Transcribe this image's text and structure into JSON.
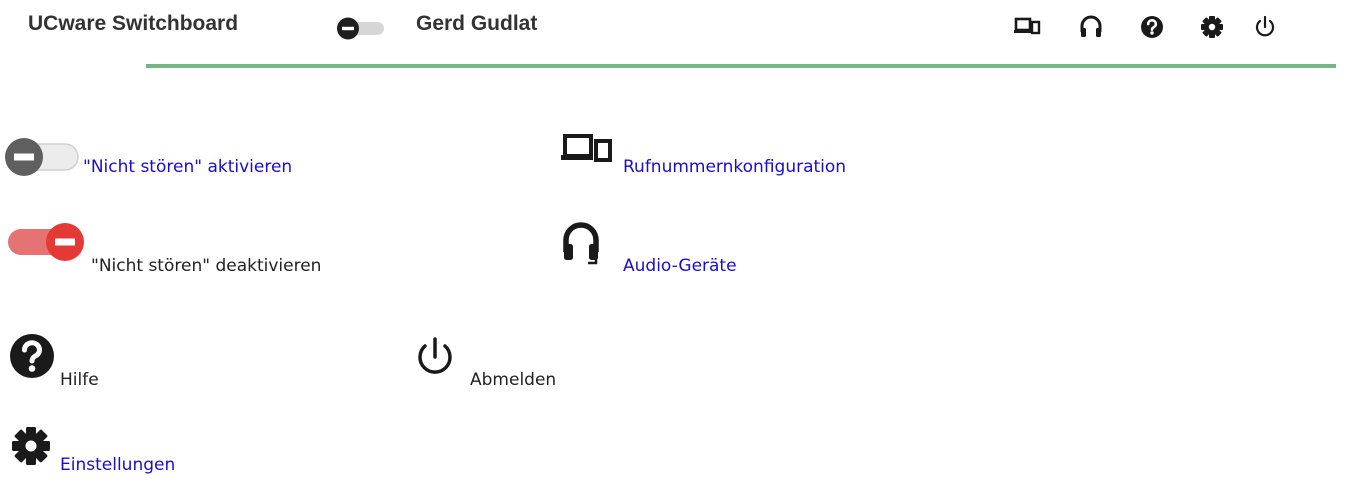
{
  "header": {
    "title": "UCware Switchboard",
    "user_name": "Gerd Gudlat",
    "toolbar_icons": [
      "devices-icon",
      "headset-icon",
      "help-icon",
      "settings-icon",
      "power-icon"
    ],
    "accent_color": "#75b685"
  },
  "legend": {
    "dnd_on_label": "\"Nicht stören\" aktivieren",
    "dnd_off_label": "\"Nicht stören\" deaktivieren",
    "phone_config_label": "Rufnummernkonfiguration",
    "audio_label": "Audio-Geräte",
    "help_label": "Hilfe",
    "logout_label": "Abmelden",
    "settings_label": "Einstellungen"
  },
  "colors": {
    "link": "#1a0dcc",
    "dnd_active": "#e53935",
    "dnd_active_track": "#e57373"
  }
}
